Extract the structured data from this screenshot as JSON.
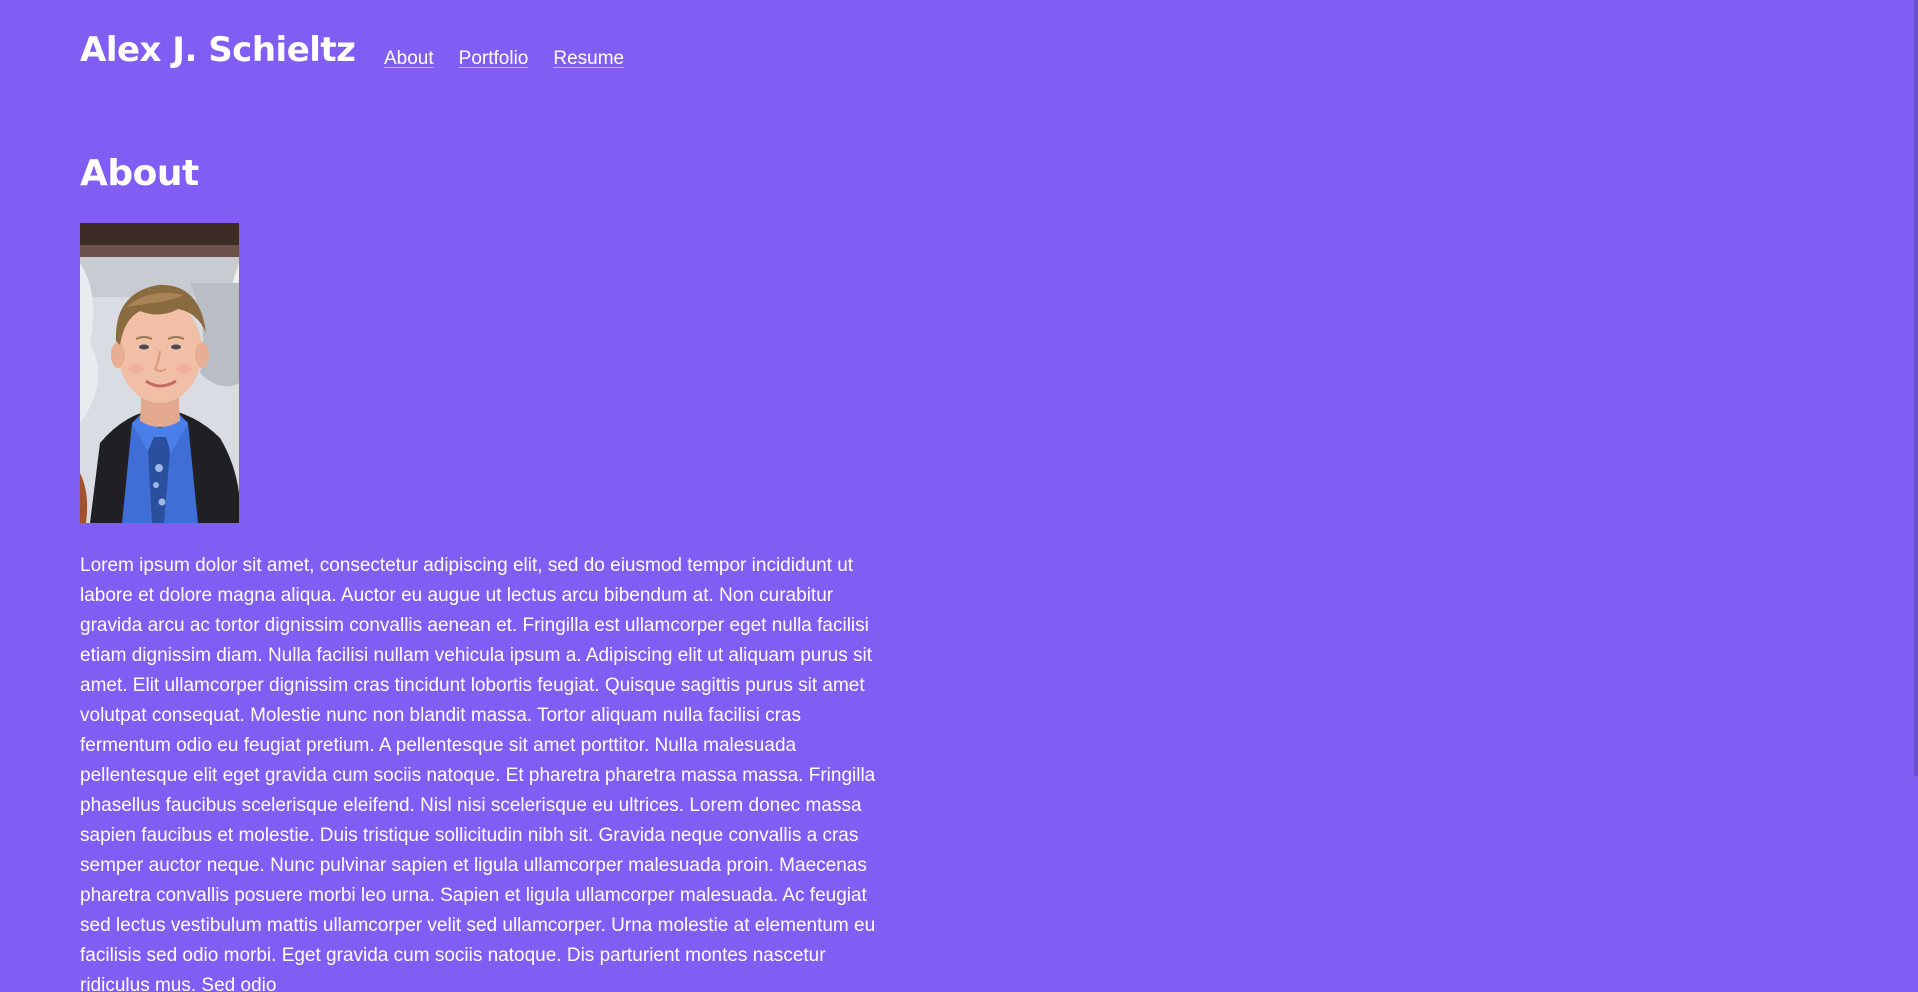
{
  "header": {
    "site_title": "Alex J. Schieltz",
    "nav": [
      {
        "label": "About"
      },
      {
        "label": "Portfolio"
      },
      {
        "label": "Resume"
      }
    ]
  },
  "main": {
    "heading": "About",
    "bio_paragraph": "Lorem ipsum dolor sit amet, consectetur adipiscing elit, sed do eiusmod tempor incididunt ut labore et dolore magna aliqua. Auctor eu augue ut lectus arcu bibendum at. Non curabitur gravida arcu ac tortor dignissim convallis aenean et. Fringilla est ullamcorper eget nulla facilisi etiam dignissim diam. Nulla facilisi nullam vehicula ipsum a. Adipiscing elit ut aliquam purus sit amet. Elit ullamcorper dignissim cras tincidunt lobortis feugiat. Quisque sagittis purus sit amet volutpat consequat. Molestie nunc non blandit massa. Tortor aliquam nulla facilisi cras fermentum odio eu feugiat pretium. A pellentesque sit amet porttitor. Nulla malesuada pellentesque elit eget gravida cum sociis natoque. Et pharetra pharetra massa massa. Fringilla phasellus faucibus scelerisque eleifend. Nisl nisi scelerisque eu ultrices. Lorem donec massa sapien faucibus et molestie. Duis tristique sollicitudin nibh sit. Gravida neque convallis a cras semper auctor neque. Nunc pulvinar sapien et ligula ullamcorper malesuada proin. Maecenas pharetra convallis posuere morbi leo urna. Sapien et ligula ullamcorper malesuada. Ac feugiat sed lectus vestibulum mattis ullamcorper velit sed ullamcorper. Urna molestie at elementum eu facilisis sed odio morbi. Eget gravida cum sociis natoque. Dis parturient montes nascetur ridiculus mus. Sed odio"
  },
  "colors": {
    "background": "#805ef3",
    "text": "#ffffff",
    "link_underline": "#f7a9b5"
  }
}
